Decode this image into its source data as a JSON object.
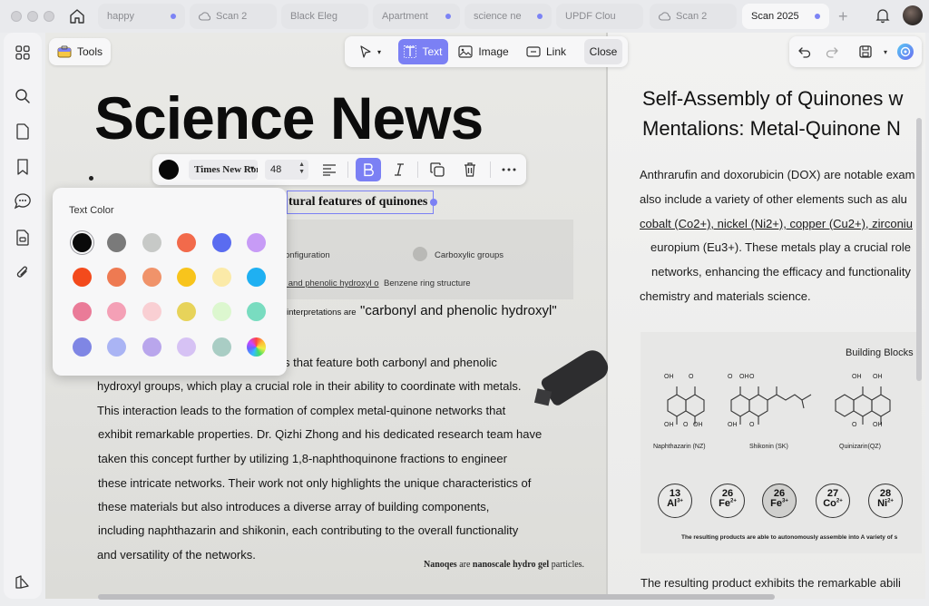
{
  "tabs": [
    {
      "label": "happy",
      "icon": "",
      "dot": true
    },
    {
      "label": "Scan 2",
      "icon": "cloud-icon",
      "dot": false
    },
    {
      "label": "Black Eleg",
      "icon": "",
      "dot": false
    },
    {
      "label": "Apartment",
      "icon": "",
      "dot": true
    },
    {
      "label": "science ne",
      "icon": "",
      "dot": true
    },
    {
      "label": "UPDF Clou",
      "icon": "",
      "dot": false
    },
    {
      "label": "Scan 2",
      "icon": "cloud-icon",
      "dot": false
    },
    {
      "label": "Scan 2025",
      "icon": "",
      "dot": true,
      "active": true
    }
  ],
  "toolbar": {
    "tools_label": "Tools",
    "text_label": "Text",
    "image_label": "Image",
    "link_label": "Link",
    "close_label": "Close"
  },
  "format_bar": {
    "font": "Times New Roman",
    "size": "48"
  },
  "color_popover": {
    "title": "Text Color",
    "rows": [
      [
        "#0a0a0a",
        "#7a7a7a",
        "#c7c9c7",
        "#f26a4b",
        "#5a6cf0",
        "#c79bf6"
      ],
      [
        "#f34a1c",
        "#ee7a52",
        "#f0936a",
        "#f8c41c",
        "#fbeaa8",
        "#1fb0f2"
      ],
      [
        "#ea7b98",
        "#f4a0b6",
        "#f9cfd3",
        "#e7d35a",
        "#dcf7cf",
        "#79dcc0"
      ],
      [
        "#7f86e4",
        "#aab4f4",
        "#b9a6ec",
        "#d6c2f4",
        "#a9cdc4",
        "rainbow"
      ]
    ]
  },
  "left_page": {
    "title": "Science News",
    "selected_text": "tural features of quinones",
    "figure": {
      "configuration": "onfiguration",
      "carboxylic": "Carboxylic groups",
      "carbonyl_phenolic": "l and phenolic hydroxyl o",
      "benzene": "Benzene ring structure"
    },
    "interp_small": "interpretations are",
    "interp_large": "\"carbonyl and phenolic hydroxyl\"",
    "body": [
      "s that feature both carbonyl and phenolic",
      "hydroxyl groups, which play a crucial role in their ability to coordinate with metals.",
      "This interaction leads to the formation of complex metal-quinone networks that",
      "exhibit remarkable properties. Dr. Qizhi Zhong and his dedicated research team have",
      "taken this concept further by utilizing 1,8-naphthoquinone fractions to engineer",
      "these intricate networks. Their work not only highlights the unique characteristics of",
      "these materials but also introduces a diverse array of building components,",
      "including naphthazarin and shikonin, each contributing to the overall functionality",
      "and versatility of the networks."
    ],
    "nanoqes_1": "Nanoqes",
    "nanoqes_2": "are",
    "nanoqes_3": "nanoscale hydro gel",
    "nanoqes_4": "particles."
  },
  "right_page": {
    "title_1": "Self-Assembly of Quinones w",
    "title_2": "Mentalions: Metal-Quinone N",
    "lines": [
      "Anthrarufin and doxorubicin (DOX) are notable exam",
      "also include a variety of other elements such as alu",
      "cobalt (Co2+), nickel (Ni2+), copper (Cu2+), zirconiu",
      "europium (Eu3+). These metals play a crucial role",
      "networks, enhancing the efficacy and functionality",
      "chemistry and materials science."
    ],
    "building_blocks": "Building Blocks",
    "molecules": [
      "Naphthazarin (NZ)",
      "Shikonin (SK)",
      "Quinizarin(QZ)"
    ],
    "mol_labels": [
      "OH",
      "O",
      "OH",
      "O",
      "OH",
      "O",
      "OH",
      "O",
      "OH",
      "O",
      "OH",
      "OH",
      "O",
      "OH",
      "O",
      "OH",
      "O"
    ],
    "ions": [
      {
        "num": "13",
        "sym": "Al",
        "charge": "3+"
      },
      {
        "num": "26",
        "sym": "Fe",
        "charge": "2+"
      },
      {
        "num": "26",
        "sym": "Fe",
        "charge": "3+"
      },
      {
        "num": "27",
        "sym": "Co",
        "charge": "2+"
      },
      {
        "num": "28",
        "sym": "Ni",
        "charge": "2+"
      }
    ],
    "caption": "The resulting products are able to autonomously assemble into A variety of s",
    "bottom_line": "The resulting product exhibits the remarkable abili"
  }
}
